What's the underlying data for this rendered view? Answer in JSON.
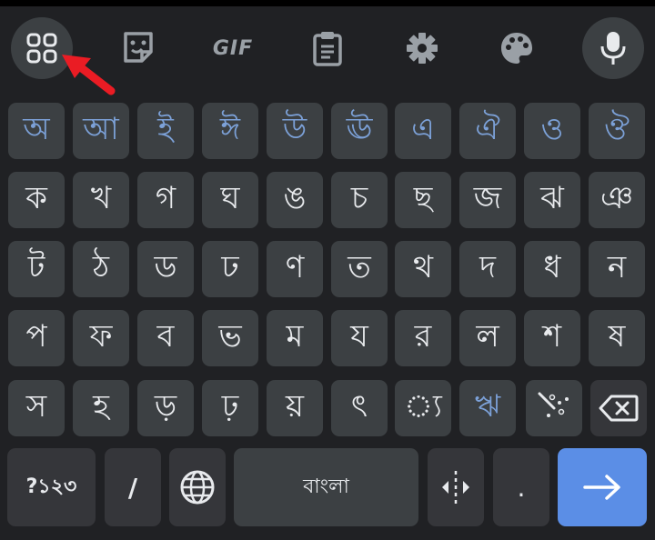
{
  "toolbar": {
    "icons": [
      "apps-grid-icon",
      "sticker-icon",
      "gif-icon",
      "clipboard-icon",
      "settings-gear-icon",
      "palette-icon",
      "microphone-icon"
    ],
    "gif_label": "GIF"
  },
  "rows": {
    "vowels": [
      "অ",
      "আ",
      "ই",
      "ঈ",
      "উ",
      "ঊ",
      "এ",
      "ঐ",
      "ও",
      "ঔ"
    ],
    "row2": [
      "ক",
      "খ",
      "গ",
      "ঘ",
      "ঙ",
      "চ",
      "ছ",
      "জ",
      "ঝ",
      "ঞ"
    ],
    "row3": [
      "ট",
      "ঠ",
      "ড",
      "ঢ",
      "ণ",
      "ত",
      "থ",
      "দ",
      "ধ",
      "ন"
    ],
    "row4": [
      "প",
      "ফ",
      "ব",
      "ভ",
      "ম",
      "য",
      "র",
      "ল",
      "শ",
      "ষ"
    ],
    "row5": [
      "স",
      "হ",
      "ড়",
      "ঢ়",
      "য়",
      "ৎ",
      "◌্য",
      "ঋ"
    ]
  },
  "bottom": {
    "symbols_label": "?১২৩",
    "slash_label": "/",
    "space_label": "বাংলা",
    "period_label": "."
  },
  "colors": {
    "background": "#202124",
    "key": "#3c4043",
    "vowel_text": "#7ca1d8",
    "enter": "#5b8ee6",
    "arrow": "#ea1c24"
  }
}
